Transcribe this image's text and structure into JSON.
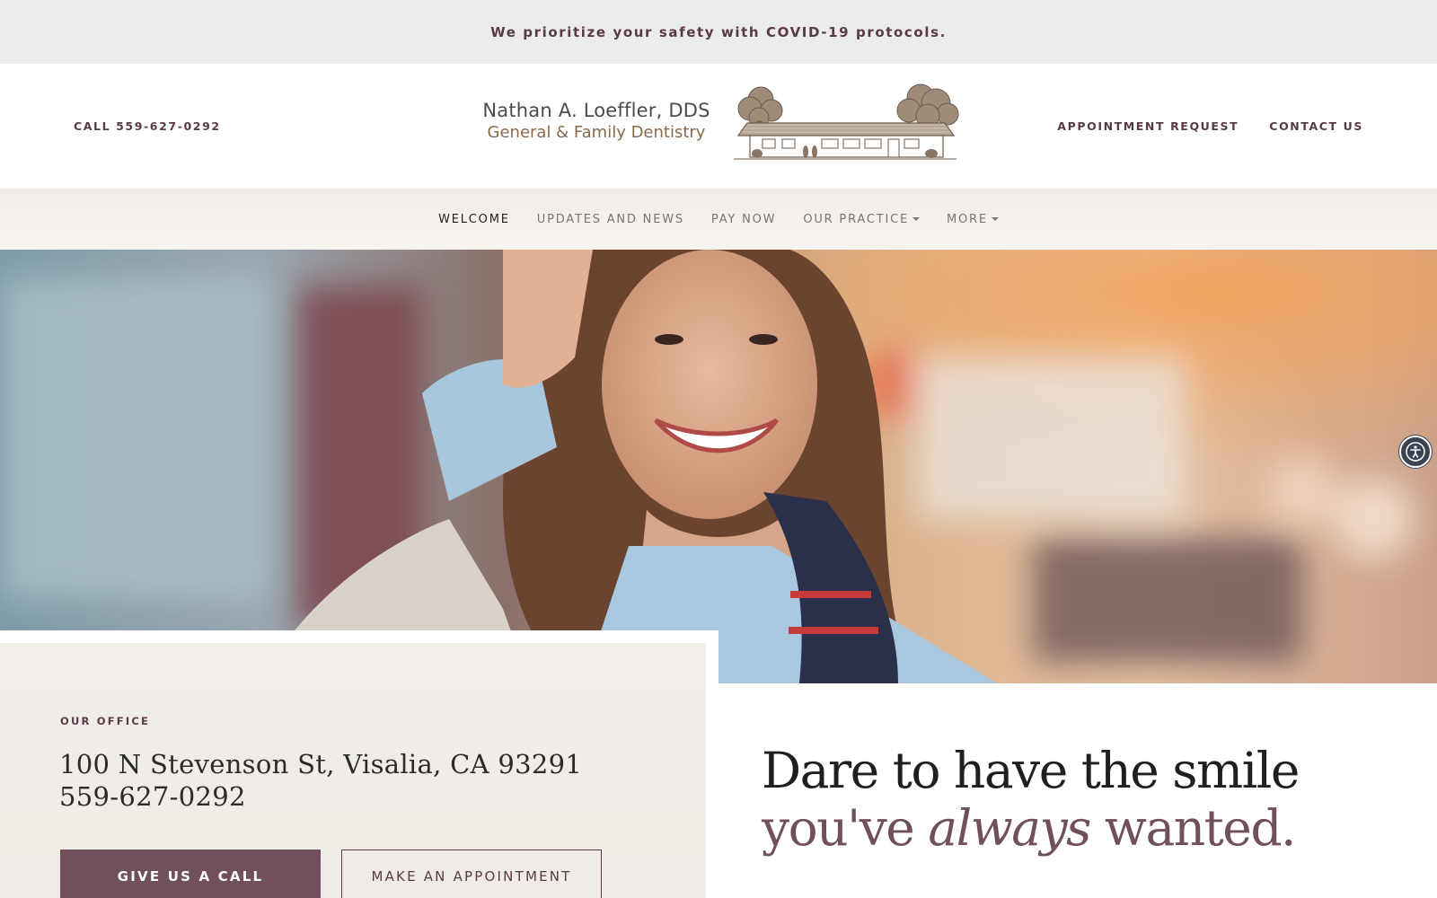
{
  "announcement": "We prioritize your safety with COVID-19 protocols.",
  "header": {
    "call_label": "CALL 559-627-0292",
    "appointment_label": "APPOINTMENT REQUEST",
    "contact_label": "CONTACT US",
    "logo_name": "Nathan A. Loeffler, DDS",
    "logo_sub": "General & Family Dentistry"
  },
  "nav": {
    "items": [
      {
        "label": "WELCOME",
        "active": true
      },
      {
        "label": "UPDATES AND NEWS"
      },
      {
        "label": "PAY NOW"
      },
      {
        "label": "OUR PRACTICE",
        "dropdown": true
      },
      {
        "label": "MORE",
        "dropdown": true
      }
    ]
  },
  "hero": {
    "image": "smiling-woman-photo",
    "accessibility_icon": "accessibility-icon"
  },
  "office": {
    "label": "OUR OFFICE",
    "address": "100 N Stevenson St, Visalia, CA 93291",
    "phone": "559-627-0292",
    "call_button": "GIVE US A CALL",
    "appointment_button": "MAKE AN APPOINTMENT"
  },
  "tagline": {
    "line1": "Dare to have the smile",
    "line2_pre": "you've ",
    "line2_em": "always",
    "line2_post": " wanted."
  },
  "colors": {
    "accent": "#6f505c",
    "text_dark": "#1f1f1f",
    "brand_brown": "#8a6a4a"
  }
}
